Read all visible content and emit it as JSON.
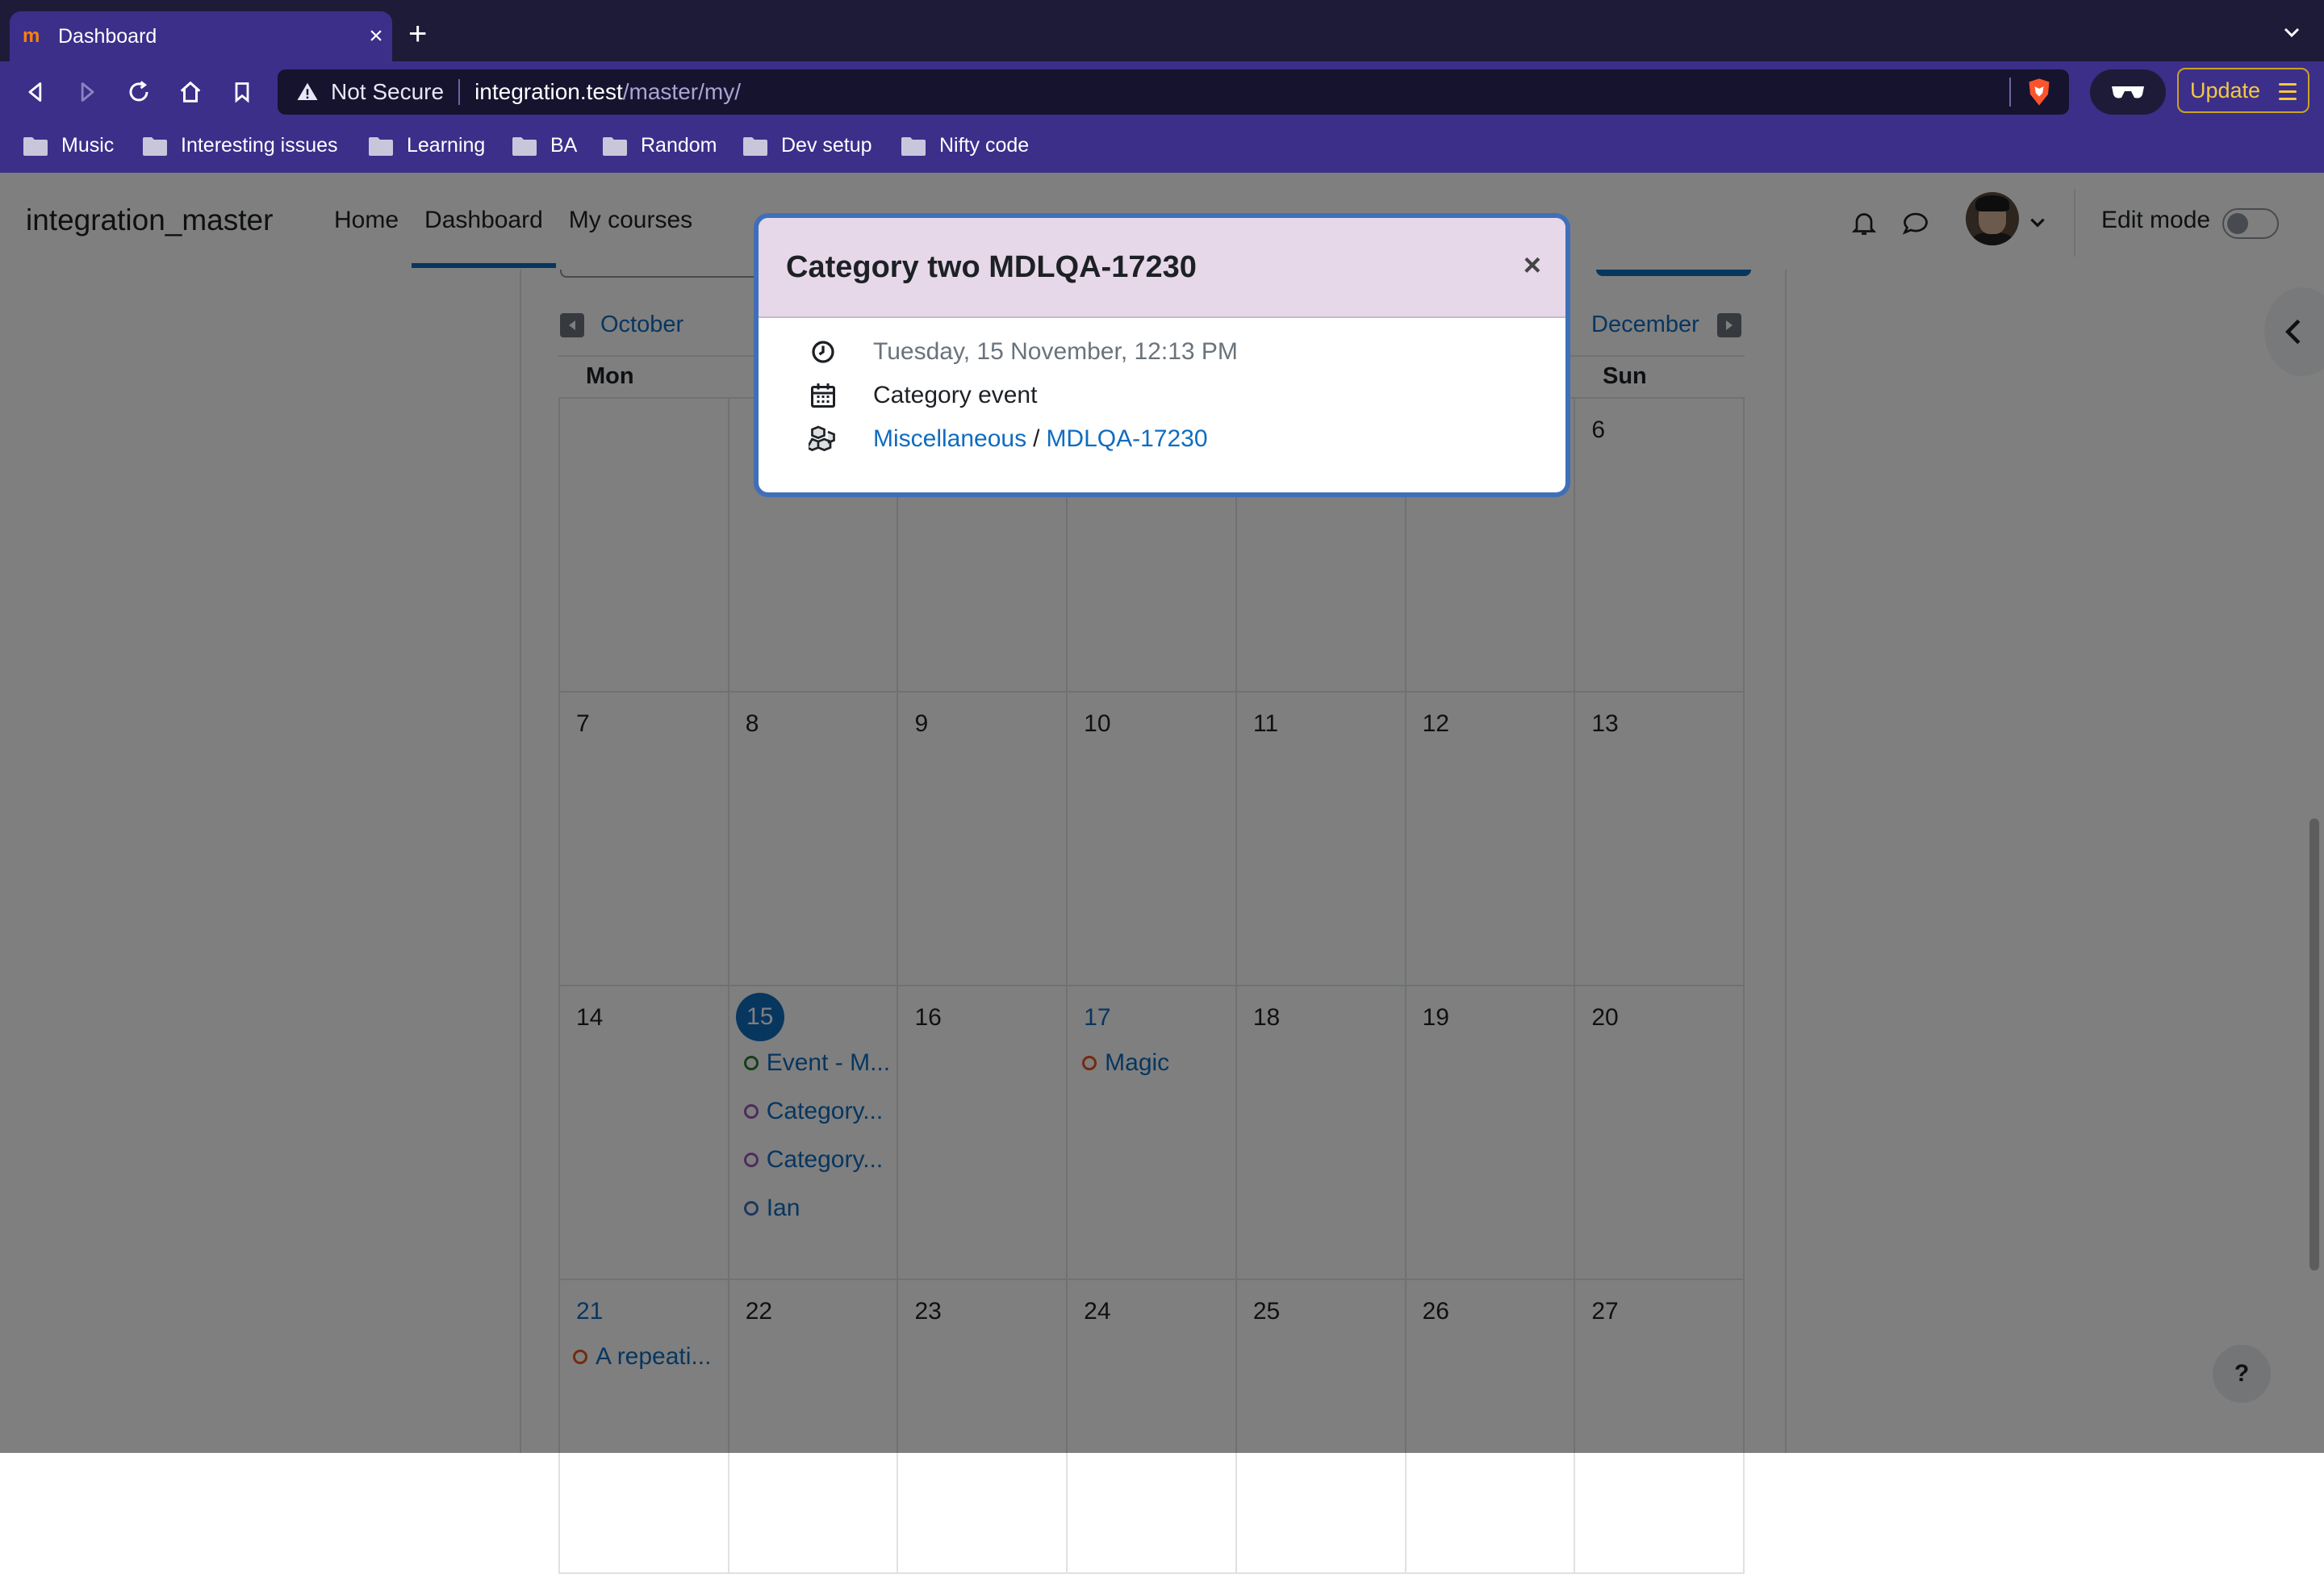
{
  "browser": {
    "tab_title": "Dashboard",
    "tab_close": "×",
    "new_tab": "+",
    "security_label": "Not Secure",
    "url_host": "integration.test",
    "url_path": "/master/my/",
    "update_label": "Update",
    "bookmarks": [
      {
        "label": "Music"
      },
      {
        "label": "Interesting issues"
      },
      {
        "label": "Learning"
      },
      {
        "label": "BA"
      },
      {
        "label": "Random"
      },
      {
        "label": "Dev setup"
      },
      {
        "label": "Nifty code"
      }
    ]
  },
  "site": {
    "name": "integration_master",
    "nav": [
      "Home",
      "Dashboard",
      "My courses"
    ],
    "edit_mode_label": "Edit mode"
  },
  "calendar": {
    "prev_month": "October",
    "next_month": "December",
    "weekday_first": "Mon",
    "weekday_last": "Sun",
    "weeks": [
      {
        "days": [
          "",
          "",
          "",
          "",
          "",
          "",
          "6"
        ]
      },
      {
        "days": [
          "7",
          "8",
          "9",
          "10",
          "11",
          "12",
          "13"
        ]
      },
      {
        "days": [
          "14",
          "15",
          "16",
          "17",
          "18",
          "19",
          "20"
        ]
      },
      {
        "days": [
          "21",
          "22",
          "23",
          "24",
          "25",
          "26",
          "27"
        ]
      }
    ],
    "events": {
      "d15": [
        "Event - M...",
        "Category...",
        "Category...",
        "Ian"
      ],
      "d17": [
        "Magic"
      ],
      "d21": [
        "A repeati..."
      ]
    },
    "event_colors": {
      "green": "#2e7d32",
      "purple": "#9b59b6",
      "blue": "#3f6fb8",
      "orange": "#e8541e"
    }
  },
  "modal": {
    "title": "Category two MDLQA-17230",
    "close": "×",
    "datetime": "Tuesday, 15 November, 12:13 PM",
    "event_type": "Category event",
    "category_link": "Miscellaneous",
    "separator": "/",
    "course_link": "MDLQA-17230"
  },
  "help_label": "?"
}
